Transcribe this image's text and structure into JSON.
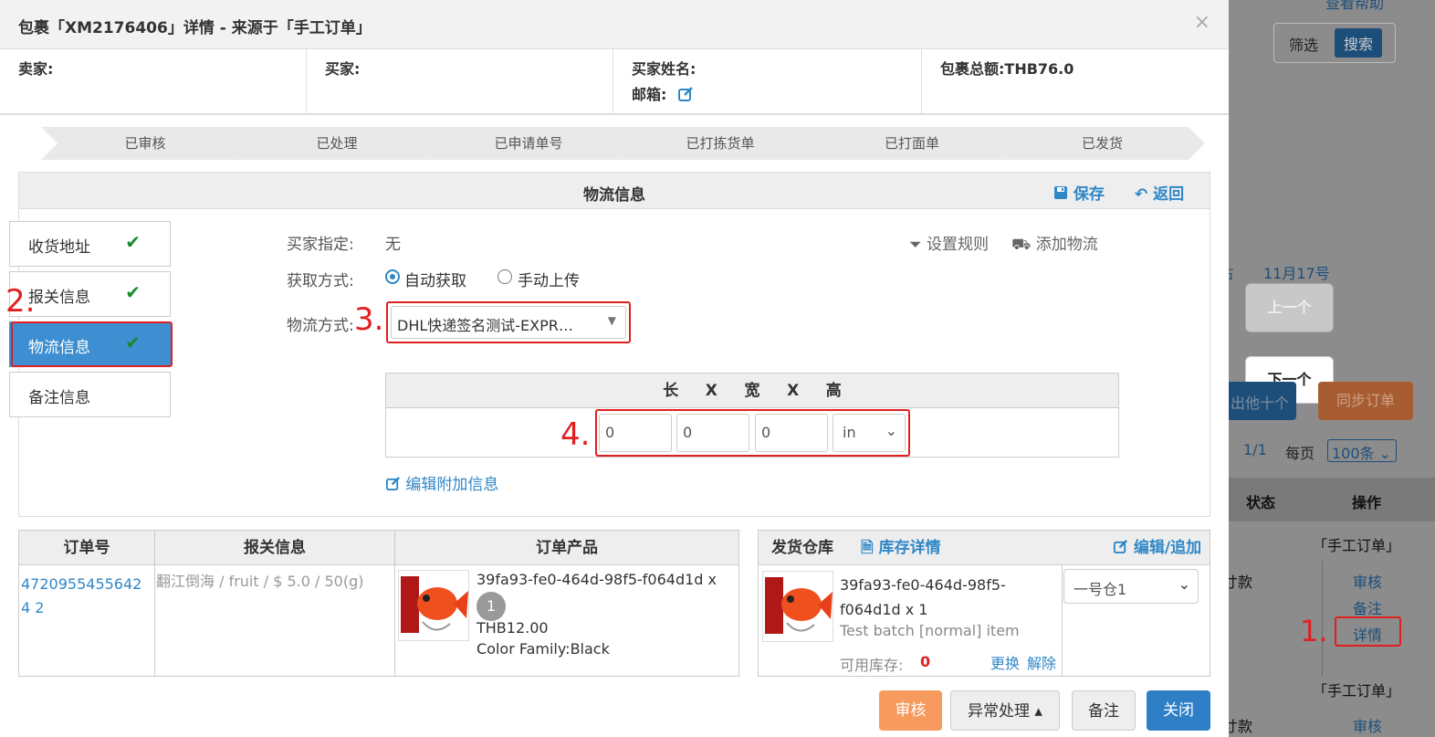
{
  "background": {
    "help": "查看帮助",
    "filter": "筛选",
    "search": "搜索",
    "date_prefix": "占",
    "date": "11月17号",
    "prev": "上一个",
    "next": "下一个",
    "export": "出他十个",
    "sync": "同步订单",
    "pager": "1/1",
    "per_page": "每页",
    "per_page_value": "100条",
    "col_status": "状态",
    "col_action": "操作",
    "row1_source": "「手工订单」",
    "row1_status": "寸款",
    "row1_actions": [
      "审核",
      "备注",
      "详情"
    ],
    "row2_source": "「手工订单」",
    "row2_status": "寸款",
    "row2_action": "审核"
  },
  "modal": {
    "title": "包裹「XM2176406」详情 - 来源于「手工订单」",
    "close": "×",
    "seller": "卖家:",
    "buyer": "买家:",
    "buyer_name": "买家姓名:",
    "email": "邮箱:",
    "total": "包裹总额:THB76.0"
  },
  "steps": [
    "已审核",
    "已处理",
    "已申请单号",
    "已打拣货单",
    "已打面单",
    "已发货"
  ],
  "logistics": {
    "title": "物流信息",
    "save": "保存",
    "back": "返回",
    "tabs": [
      {
        "label": "收货地址"
      },
      {
        "label": "报关信息"
      },
      {
        "label": "物流信息"
      },
      {
        "label": "备注信息"
      }
    ],
    "buyer_assign_label": "买家指定:",
    "buyer_assign_value": "无",
    "set_rule": "设置规则",
    "add_logistics": "添加物流",
    "fetch_label": "获取方式:",
    "auto": "自动获取",
    "manual": "手动上传",
    "method_label": "物流方式:",
    "method_value": "DHL快递签名测试-EXPR…",
    "dims_header": [
      "长",
      "X",
      "宽",
      "X",
      "高"
    ],
    "dims": [
      "0",
      "0",
      "0"
    ],
    "unit": "in",
    "edit_extra": "编辑附加信息"
  },
  "annotations": [
    "1.",
    "2.",
    "3.",
    "4."
  ],
  "order_table": {
    "headers": [
      "订单号",
      "报关信息",
      "订单产品"
    ],
    "order_no": "47209554556424 2",
    "customs": "翻江倒海 / fruit / $ 5.0 / 50(g)",
    "product_sku": "39fa93-fe0-464d-98f5-f064d1d x",
    "qty": "1",
    "price": "THB12.00",
    "attr": "Color Family:Black"
  },
  "warehouse_table": {
    "title": "发货仓库",
    "stock_detail": "库存详情",
    "edit_add": "编辑/追加",
    "sku": "39fa93-fe0-464d-98f5-f064d1d x 1",
    "batch": "Test batch [normal] item",
    "avail_label": "可用库存:",
    "avail_value": "0",
    "swap": "更换",
    "release": "解除",
    "warehouse": "一号仓1"
  },
  "footer": {
    "audit": "审核",
    "exception": "异常处理 ▴",
    "note": "备注",
    "close": "关闭"
  },
  "colors": {
    "blue": "#2f87c8",
    "orange": "#f79a5e",
    "red": "#e02020",
    "green": "#1a8a2a"
  }
}
